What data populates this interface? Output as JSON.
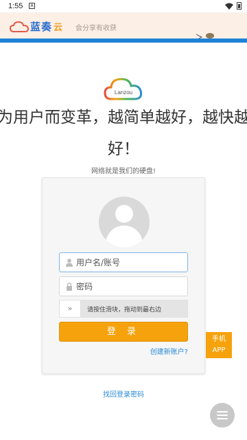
{
  "status_bar": {
    "time": "1:55",
    "notification": "A"
  },
  "banner": {
    "brand": "蓝奏",
    "brand_suffix": "云",
    "slogan": "会分享有收获"
  },
  "header": {
    "logo_text": "Lanzou",
    "headline_line1": "为用户而变革，越简单越好，越快越",
    "headline_line2": "好！",
    "subline": "网络就是我们的硬盘!"
  },
  "login": {
    "username_placeholder": "用户名/账号",
    "password_placeholder": "密码",
    "slider_handle": "»",
    "slider_text": "请按住滑块，拖动到最右边",
    "submit_label": "登 录",
    "register_link": "创建新账户?"
  },
  "app_tag": {
    "line1": "手机",
    "line2": "APP"
  },
  "forgot_link": "找回登录密码",
  "colors": {
    "accent": "#f5a20c",
    "link": "#2a8ad6",
    "banner_stripe": "#1e82d8"
  },
  "icons": [
    "wifi-icon",
    "battery-icon",
    "cloud-logo-icon",
    "user-icon",
    "lock-icon",
    "menu-icon"
  ]
}
